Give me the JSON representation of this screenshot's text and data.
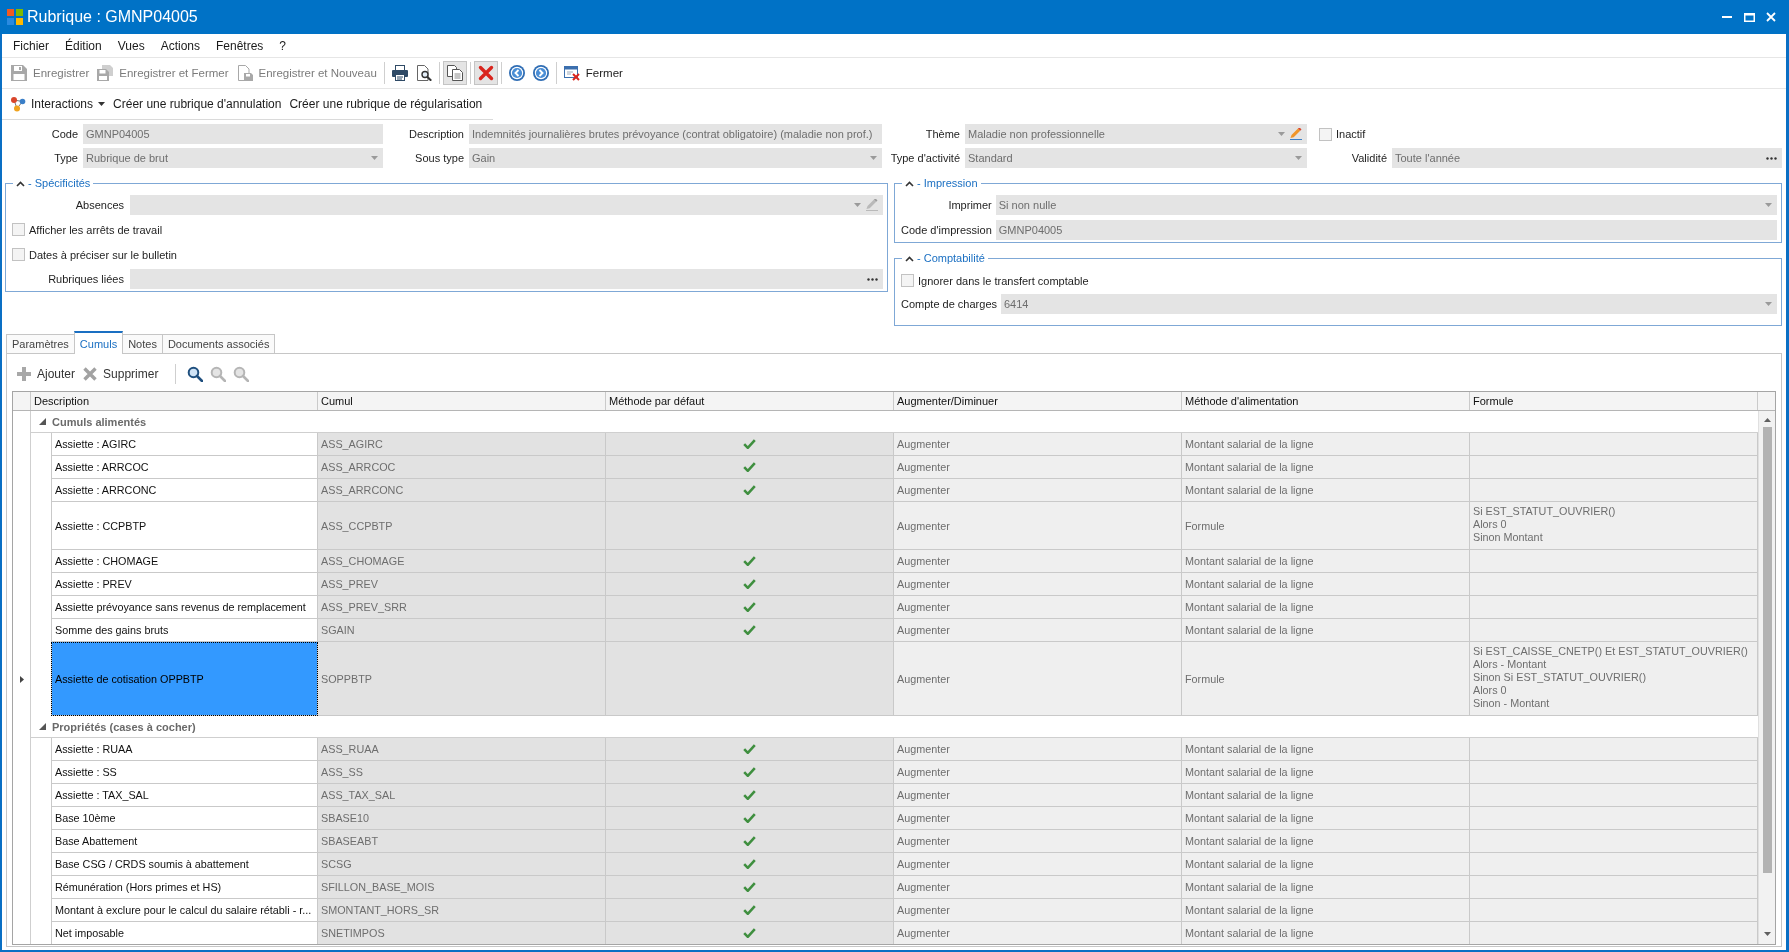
{
  "window": {
    "title": "Rubrique : GMNP04005"
  },
  "menu": [
    "Fichier",
    "Édition",
    "Vues",
    "Actions",
    "Fenêtres",
    "?"
  ],
  "toolbar": [
    [
      {
        "label": "Enregistrer",
        "disabled": true
      },
      {
        "label": "Enregistrer et Fermer",
        "disabled": true
      },
      {
        "label": "Enregistrer et Nouveau",
        "disabled": true
      }
    ],
    [
      {
        "pressed": false
      },
      {
        "pressed": false
      }
    ],
    [
      {
        "pressed": true
      }
    ],
    [
      {
        "pressed": true
      }
    ],
    [
      {
        "pressed": false
      },
      {
        "pressed": false
      }
    ],
    [
      {
        "label": "Fermer",
        "disabled": false
      }
    ]
  ],
  "interactions": {
    "menu": "Interactions",
    "actions": [
      "Créer une rubrique d'annulation",
      "Créer une rubrique de régularisation"
    ]
  },
  "header_fields": [
    {
      "label": "Code",
      "kind": "text",
      "value": "GMNP04005"
    },
    {
      "label": "Description",
      "kind": "text",
      "value": "Indemnités journalières brutes prévoyance (contrat obligatoire) (maladie non prof.)"
    },
    {
      "label": "Thème",
      "kind": "combo-edit",
      "value": "Maladie non professionnelle",
      "edit_enabled": true
    },
    {
      "label": "Inactif",
      "kind": "checkbox",
      "checked": false
    },
    {
      "label": "Type",
      "kind": "combo",
      "value": "Rubrique de brut"
    },
    {
      "label": "Sous type",
      "kind": "combo",
      "value": "Gain"
    },
    {
      "label": "Type d'activité",
      "kind": "combo",
      "value": "Standard"
    },
    {
      "label": "Validité",
      "kind": "ellipsis",
      "value": "Toute l'année"
    }
  ],
  "groups": [
    {
      "title": "- Spécificités",
      "expanded": true,
      "fields": [
        {
          "label": "Absences",
          "kind": "combo-edit",
          "edit_enabled": false
        },
        {
          "label": "Afficher les arrêts de travail",
          "kind": "checkbox",
          "checked": false
        },
        {
          "label": "Dates à préciser sur le bulletin",
          "kind": "checkbox",
          "checked": false
        },
        {
          "label": "Rubriques liées",
          "kind": "ellipsis"
        }
      ]
    },
    {
      "title": "- Impression",
      "expanded": true,
      "fields": [
        {
          "label": "Imprimer",
          "kind": "combo",
          "value": "Si non nulle"
        },
        {
          "label": "Code d'impression",
          "kind": "text",
          "value": "GMNP04005"
        }
      ]
    },
    {
      "title": "- Comptabilité",
      "expanded": true,
      "fields": [
        {
          "label": "Ignorer dans le transfert comptable",
          "kind": "checkbox",
          "checked": false
        },
        {
          "label": "Compte de charges",
          "kind": "combo",
          "value": "6414"
        }
      ]
    }
  ],
  "tabs": [
    {
      "label": "Paramètres",
      "selected": false
    },
    {
      "label": "Cumuls",
      "selected": true
    },
    {
      "label": "Notes",
      "selected": false
    },
    {
      "label": "Documents associés",
      "selected": false
    }
  ],
  "grid_toolbar": {
    "buttons": [
      "Ajouter",
      "Supprimer"
    ],
    "search_buttons": [
      {
        "disabled": false
      },
      {
        "disabled": true
      },
      {
        "disabled": true
      }
    ]
  },
  "table": {
    "columns": [
      "Description",
      "Cumul",
      "Méthode par défaut",
      "Augmenter/Diminuer",
      "Méthode d'alimentation",
      "Formule"
    ],
    "groups": [
      {
        "label": "Cumuls alimentés",
        "expanded": true,
        "rows": [
          {
            "description": "Assiette : AGIRC",
            "cumul": "ASS_AGIRC",
            "default_method": true,
            "direction": "Augmenter",
            "feed_method": "Montant salarial de la ligne",
            "selected": false
          },
          {
            "description": "Assiette : ARRCOC",
            "cumul": "ASS_ARRCOC",
            "default_method": true,
            "direction": "Augmenter",
            "feed_method": "Montant salarial de la ligne",
            "selected": false
          },
          {
            "description": "Assiette : ARRCONC",
            "cumul": "ASS_ARRCONC",
            "default_method": true,
            "direction": "Augmenter",
            "feed_method": "Montant salarial de la ligne",
            "selected": false
          },
          {
            "description": "Assiette : CCPBTP",
            "cumul": "ASS_CCPBTP",
            "default_method": false,
            "direction": "Augmenter",
            "feed_method": "Formule",
            "formula": "Si EST_STATUT_OUVRIER()\nAlors 0\nSinon Montant",
            "selected": false
          },
          {
            "description": "Assiette : CHOMAGE",
            "cumul": "ASS_CHOMAGE",
            "default_method": true,
            "direction": "Augmenter",
            "feed_method": "Montant salarial de la ligne",
            "selected": false
          },
          {
            "description": "Assiette : PREV",
            "cumul": "ASS_PREV",
            "default_method": true,
            "direction": "Augmenter",
            "feed_method": "Montant salarial de la ligne",
            "selected": false
          },
          {
            "description": "Assiette prévoyance sans revenus de remplacement",
            "cumul": "ASS_PREV_SRR",
            "default_method": true,
            "direction": "Augmenter",
            "feed_method": "Montant salarial de la ligne",
            "selected": false
          },
          {
            "description": "Somme des gains bruts",
            "cumul": "SGAIN",
            "default_method": true,
            "direction": "Augmenter",
            "feed_method": "Montant salarial de la ligne",
            "selected": false
          },
          {
            "description": "Assiette de cotisation OPPBTP",
            "cumul": "SOPPBTP",
            "default_method": false,
            "direction": "Augmenter",
            "feed_method": "Formule",
            "formula": "Si EST_CAISSE_CNETP() Et EST_STATUT_OUVRIER()\nAlors - Montant\nSinon Si EST_STATUT_OUVRIER()\nAlors 0\nSinon - Montant",
            "selected": true
          }
        ]
      },
      {
        "label": "Propriétés (cases à cocher)",
        "expanded": true,
        "rows": [
          {
            "description": "Assiette : RUAA",
            "cumul": "ASS_RUAA",
            "default_method": true,
            "direction": "Augmenter",
            "feed_method": "Montant salarial de la ligne",
            "selected": false
          },
          {
            "description": "Assiette : SS",
            "cumul": "ASS_SS",
            "default_method": true,
            "direction": "Augmenter",
            "feed_method": "Montant salarial de la ligne",
            "selected": false
          },
          {
            "description": "Assiette : TAX_SAL",
            "cumul": "ASS_TAX_SAL",
            "default_method": true,
            "direction": "Augmenter",
            "feed_method": "Montant salarial de la ligne",
            "selected": false
          },
          {
            "description": "Base 10ème",
            "cumul": "SBASE10",
            "default_method": true,
            "direction": "Augmenter",
            "feed_method": "Montant salarial de la ligne",
            "selected": false
          },
          {
            "description": "Base Abattement",
            "cumul": "SBASEABT",
            "default_method": true,
            "direction": "Augmenter",
            "feed_method": "Montant salarial de la ligne",
            "selected": false
          },
          {
            "description": "Base CSG / CRDS soumis à abattement",
            "cumul": "SCSG",
            "default_method": true,
            "direction": "Augmenter",
            "feed_method": "Montant salarial de la ligne",
            "selected": false
          },
          {
            "description": "Rémunération (Hors primes et HS)",
            "cumul": "SFILLON_BASE_MOIS",
            "default_method": true,
            "direction": "Augmenter",
            "feed_method": "Montant salarial de la ligne",
            "selected": false
          },
          {
            "description": "Montant à exclure pour le calcul du salaire rétabli - r...",
            "cumul": "SMONTANT_HORS_SR",
            "default_method": true,
            "direction": "Augmenter",
            "feed_method": "Montant salarial de la ligne",
            "selected": false
          },
          {
            "description": "Net imposable",
            "cumul": "SNETIMPOS",
            "default_method": true,
            "direction": "Augmenter",
            "feed_method": "Montant salarial de la ligne",
            "selected": false
          }
        ]
      }
    ]
  }
}
